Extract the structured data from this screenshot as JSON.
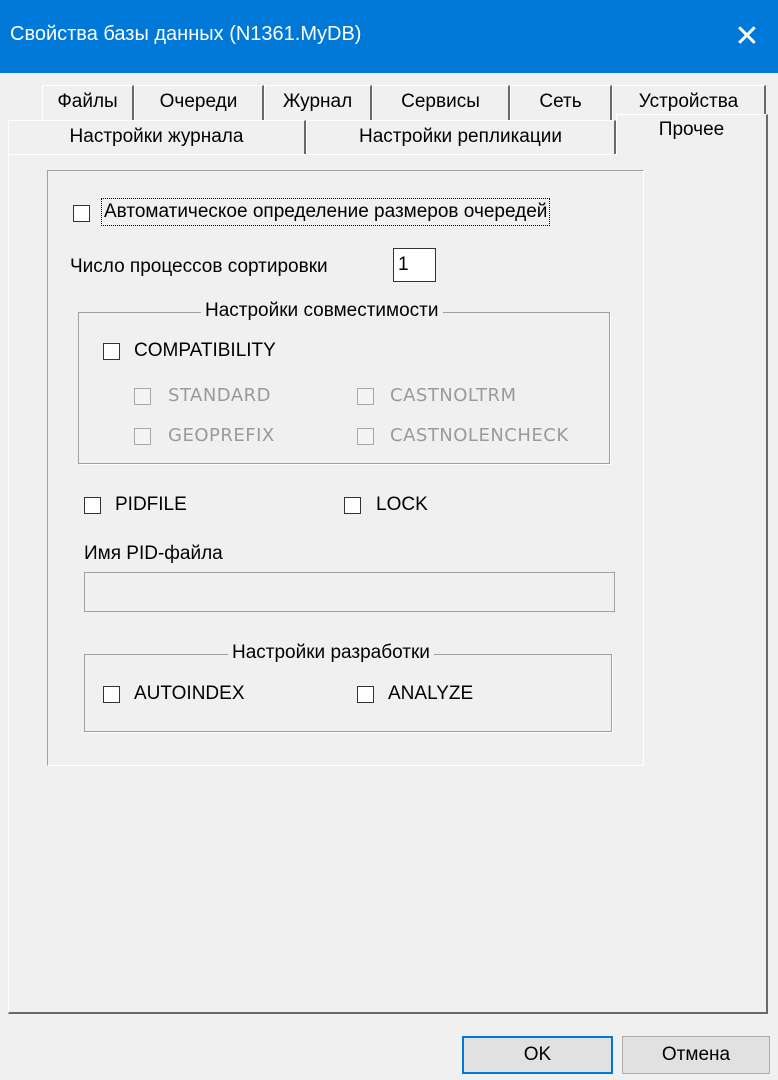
{
  "window": {
    "title": "Свойства базы данных (N1361.MyDB)",
    "close_glyph": "✕"
  },
  "tabs_row1": [
    "Файлы",
    "Очереди",
    "Журнал",
    "Сервисы",
    "Сеть",
    "Устройства"
  ],
  "tabs_row2": [
    "Настройки журнала",
    "Настройки репликации",
    "Прочее"
  ],
  "active_tab": "Прочее",
  "auto_queue": {
    "label": "Автоматическое определение размеров очередей",
    "checked": false
  },
  "sort_processes": {
    "label": "Число процессов сортировки",
    "value": "1"
  },
  "compat": {
    "title": "Настройки совместимости",
    "main": {
      "label": "COMPATIBILITY",
      "checked": false
    },
    "standard": "STANDARD",
    "castnoltrm": "CASTNOLTRM",
    "geoprefix": "GEOPREFIX",
    "castnolencheck": "CASTNOLENCHECK"
  },
  "pidfile": {
    "label": "PIDFILE",
    "checked": false
  },
  "lock": {
    "label": "LOCK",
    "checked": false
  },
  "pid_name": {
    "label": "Имя PID-файла",
    "value": ""
  },
  "dev": {
    "title": "Настройки разработки",
    "autoindex": {
      "label": "AUTOINDEX",
      "checked": false
    },
    "analyze": {
      "label": "ANALYZE",
      "checked": false
    }
  },
  "buttons": {
    "ok": "OK",
    "cancel": "Отмена"
  },
  "colors": {
    "titlebar": "#0078d7",
    "face": "#f0f0f0",
    "disabled_text": "#9a9a9a"
  }
}
